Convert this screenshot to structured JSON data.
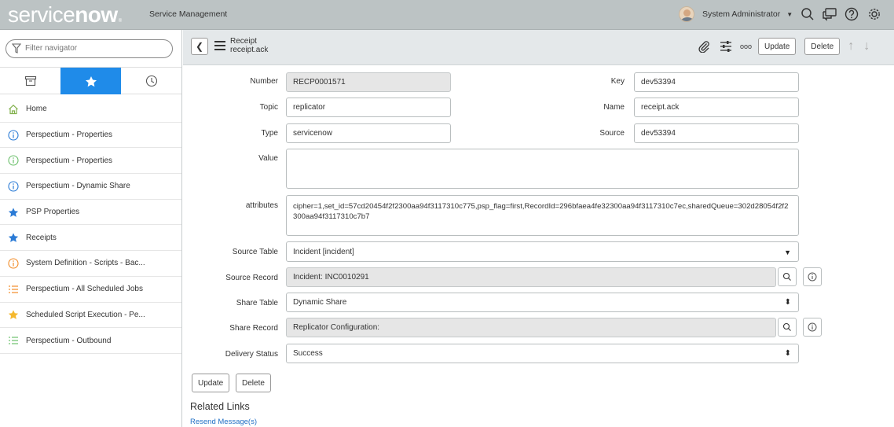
{
  "banner": {
    "logo_service": "service",
    "logo_now": "now",
    "logo_tm": "®",
    "title": "Service Management",
    "user_name": "System Administrator",
    "icons": [
      "search-icon",
      "chat-icon",
      "help-icon",
      "gear-icon"
    ]
  },
  "nav": {
    "filter_placeholder": "Filter navigator",
    "tabs": [
      "all-apps-icon",
      "favorites-star-icon",
      "history-clock-icon"
    ],
    "items": [
      {
        "label": "Home",
        "icon": "home-icon",
        "color": "#81b04b"
      },
      {
        "label": "Perspectium - Properties",
        "icon": "info-circle-icon",
        "color": "#2b7bd6"
      },
      {
        "label": "Perspectium - Properties",
        "icon": "info-circle-icon",
        "color": "#6cc06c"
      },
      {
        "label": "Perspectium - Dynamic Share",
        "icon": "info-circle-icon",
        "color": "#2b7bd6"
      },
      {
        "label": "PSP Properties",
        "icon": "star-icon",
        "color": "#2b7bd6"
      },
      {
        "label": "Receipts",
        "icon": "star-icon",
        "color": "#2b7bd6"
      },
      {
        "label": "System Definition - Scripts - Bac...",
        "icon": "info-circle-icon",
        "color": "#f28c28"
      },
      {
        "label": "Perspectium - All Scheduled Jobs",
        "icon": "list-icon",
        "color": "#f28c28"
      },
      {
        "label": "Scheduled Script Execution - Pe...",
        "icon": "star-icon",
        "color": "#f5b82e"
      },
      {
        "label": "Perspectium - Outbound",
        "icon": "list-icon",
        "color": "#6cc06c"
      }
    ]
  },
  "header": {
    "title": "Receipt",
    "subtitle": "receipt.ack",
    "update_label": "Update",
    "delete_label": "Delete",
    "more_label": "ooo"
  },
  "form": {
    "number_label": "Number",
    "number_value": "RECP0001571",
    "key_label": "Key",
    "key_value": "dev53394",
    "topic_label": "Topic",
    "topic_value": "replicator",
    "name_label": "Name",
    "name_value": "receipt.ack",
    "type_label": "Type",
    "type_value": "servicenow",
    "source_label": "Source",
    "source_value": "dev53394",
    "value_label": "Value",
    "value_value": "",
    "attributes_label": "attributes",
    "attributes_value": "cipher=1,set_id=57cd20454f2f2300aa94f3117310c775,psp_flag=first,RecordId=296bfaea4fe32300aa94f3117310c7ec,sharedQueue=302d28054f2f2300aa94f3117310c7b7",
    "source_table_label": "Source Table",
    "source_table_value": "Incident [incident]",
    "source_record_label": "Source Record",
    "source_record_value": "Incident: INC0010291",
    "share_table_label": "Share Table",
    "share_table_value": "Dynamic Share",
    "share_record_label": "Share Record",
    "share_record_value": "Replicator Configuration:",
    "delivery_status_label": "Delivery Status",
    "delivery_status_value": "Success",
    "update_label": "Update",
    "delete_label": "Delete"
  },
  "related": {
    "heading": "Related Links",
    "link": "Resend Message(s)"
  },
  "colors": {
    "banner_bg": "#bcc3c4",
    "active_tab": "#1f8be9",
    "link": "#1f6fc5"
  }
}
